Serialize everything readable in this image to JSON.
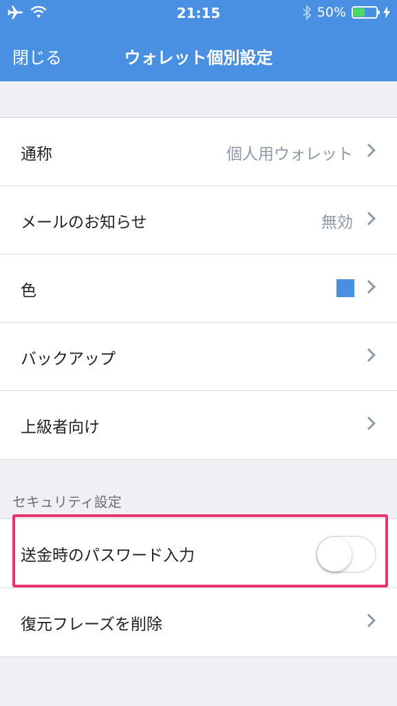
{
  "status_bar": {
    "time": "21:15",
    "battery_percent": "50%",
    "battery_level": 0.5,
    "icons": [
      "airplane-icon",
      "wifi-icon",
      "bluetooth-icon",
      "battery-icon",
      "charging-icon"
    ]
  },
  "nav": {
    "close_label": "閉じる",
    "title": "ウォレット個別設定"
  },
  "general_settings": {
    "nickname": {
      "label": "通称",
      "value": "個人用ウォレット"
    },
    "mail_notice": {
      "label": "メールのお知らせ",
      "value": "無効"
    },
    "color": {
      "label": "色",
      "swatch": "#4a90e2"
    },
    "backup": {
      "label": "バックアップ"
    },
    "advanced": {
      "label": "上級者向け"
    }
  },
  "security": {
    "header": "セキュリティ設定",
    "send_password": {
      "label": "送金時のパスワード入力",
      "enabled": false
    },
    "delete_phrase": {
      "label": "復元フレーズを削除"
    }
  },
  "colors": {
    "header_bg": "#4a90e2",
    "highlight": "#e8336e"
  }
}
